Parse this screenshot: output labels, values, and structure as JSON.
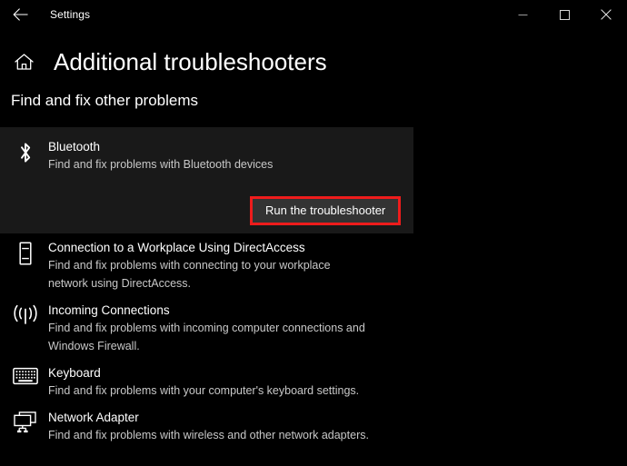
{
  "window": {
    "app_title": "Settings",
    "back_icon": "back-arrow-icon",
    "minimize_label": "Minimize",
    "maximize_label": "Maximize",
    "close_label": "Close"
  },
  "header": {
    "home_icon": "home-icon",
    "title": "Additional troubleshooters",
    "subtitle": "Find and fix other problems"
  },
  "colors": {
    "page_background": "#000000",
    "card_background": "#191919",
    "highlight_border": "#ee1c1c",
    "button_background": "#333333",
    "title_text": "#ffffff",
    "description_text": "#c8c8c8"
  },
  "selected_card": {
    "icon": "bluetooth-icon",
    "title": "Bluetooth",
    "description": "Find and fix problems with Bluetooth devices",
    "button_label": "Run the troubleshooter",
    "highlighted": true
  },
  "troubleshooters": [
    {
      "icon": "directaccess-device-icon",
      "title": "Connection to a Workplace Using DirectAccess",
      "description_line1": "Find and fix problems with connecting to your workplace",
      "description_line2": "network using DirectAccess."
    },
    {
      "icon": "incoming-connections-signal-icon",
      "title": "Incoming Connections",
      "description_line1": "Find and fix problems with incoming computer connections and",
      "description_line2": "Windows Firewall."
    },
    {
      "icon": "keyboard-icon",
      "title": "Keyboard",
      "description_line1": "Find and fix problems with your computer's keyboard settings.",
      "description_line2": ""
    },
    {
      "icon": "network-adapter-icon",
      "title": "Network Adapter",
      "description_line1": "Find and fix problems with wireless and other network adapters.",
      "description_line2": ""
    }
  ]
}
